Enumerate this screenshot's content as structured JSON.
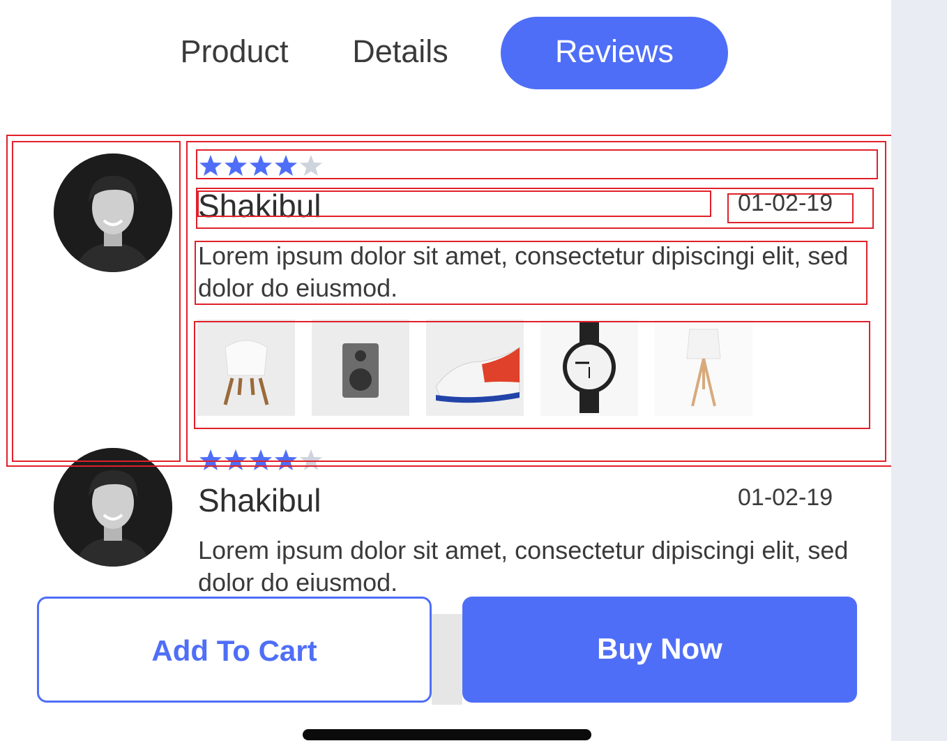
{
  "tabs": [
    {
      "label": "Product",
      "active": false
    },
    {
      "label": "Details",
      "active": false
    },
    {
      "label": "Reviews",
      "active": true
    }
  ],
  "reviews": [
    {
      "rating": 4,
      "max_rating": 5,
      "name": "Shakibul",
      "date": "01-02-19",
      "text": "Lorem ipsum dolor sit amet, consectetur dipiscingi elit, sed  dolor do eiusmod.",
      "photos": [
        "chair",
        "speaker",
        "sneaker",
        "watch",
        "lamp"
      ]
    },
    {
      "rating": 4,
      "max_rating": 5,
      "name": "Shakibul",
      "date": "01-02-19",
      "text": "Lorem ipsum dolor sit amet, consectetur dipiscingi elit, sed  dolor do eiusmod."
    }
  ],
  "buttons": {
    "add_to_cart": "Add To Cart",
    "buy_now": "Buy Now"
  },
  "colors": {
    "accent": "#4f6ef7",
    "star_filled": "#4f6ef7",
    "star_empty": "#cfd3dc",
    "annotation": "#e0202a"
  }
}
